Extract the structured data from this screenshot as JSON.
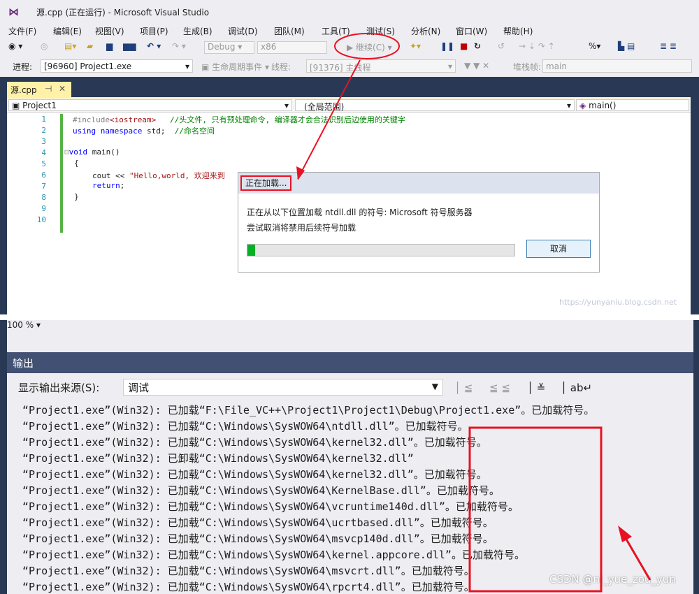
{
  "window": {
    "title": "源.cpp (正在运行) - Microsoft Visual Studio"
  },
  "menu": [
    "文件(F)",
    "编辑(E)",
    "视图(V)",
    "项目(P)",
    "生成(B)",
    "调试(D)",
    "团队(M)",
    "工具(T)",
    "测试(S)",
    "分析(N)",
    "窗口(W)",
    "帮助(H)"
  ],
  "toolbar": {
    "config": "Debug",
    "platform": "x86",
    "continue_label": "继续(C)"
  },
  "debugbar": {
    "process_label": "进程:",
    "process_value": "[96960] Project1.exe",
    "lifecycle_label": "生命周期事件",
    "thread_label": "线程:",
    "thread_value": "[91376] 主线程",
    "stack_label": "堆栈帧:",
    "stack_value": "main"
  },
  "editor": {
    "tab_label": "源.cpp",
    "nav_project": "Project1",
    "nav_scope": "(全局范围)",
    "nav_function": "main()",
    "line_numbers": [
      "1",
      "2",
      "3",
      "4",
      "5",
      "6",
      "7",
      "8",
      "9",
      "10"
    ],
    "code": {
      "l1_pp": "#include",
      "l1_str": "<iostream>",
      "l1_cm": "//头文件, 只有预处理命令, 编译器才会合法识别后边使用的关键字",
      "l2_kw": "using namespace",
      "l2_rest": " std;  ",
      "l2_cm": "//命名空间",
      "l4_kw": "void",
      "l4_rest": " main()",
      "l5": "{",
      "l6_rest": "cout << ",
      "l6_str": "\"Hello,world, 欢迎来到",
      "l7_kw": "return",
      "l8": "}"
    },
    "watermark": "https://yunyaniu.blog.csdn.net"
  },
  "dialog": {
    "title": "正在加载...",
    "message": "正在从以下位置加载 ntdll.dll 的符号: Microsoft 符号服务器",
    "hint": "尝试取消将禁用后续符号加载",
    "progress": 0.03,
    "cancel": "取消"
  },
  "output": {
    "zoom": "100 %",
    "header": "输出",
    "source_label": "显示输出来源(S):",
    "source_value": "调试",
    "lines": [
      "“Project1.exe”(Win32): 已加载“F:\\File_VC++\\Project1\\Project1\\Debug\\Project1.exe”。已加载符号。",
      "“Project1.exe”(Win32): 已加载“C:\\Windows\\SysWOW64\\ntdll.dll”。已加载符号。",
      "“Project1.exe”(Win32): 已加载“C:\\Windows\\SysWOW64\\kernel32.dll”。已加载符号。",
      "“Project1.exe”(Win32): 已卸载“C:\\Windows\\SysWOW64\\kernel32.dll”",
      "“Project1.exe”(Win32): 已加载“C:\\Windows\\SysWOW64\\kernel32.dll”。已加载符号。",
      "“Project1.exe”(Win32): 已加载“C:\\Windows\\SysWOW64\\KernelBase.dll”。已加载符号。",
      "“Project1.exe”(Win32): 已加载“C:\\Windows\\SysWOW64\\vcruntime140d.dll”。已加载符号。",
      "“Project1.exe”(Win32): 已加载“C:\\Windows\\SysWOW64\\ucrtbased.dll”。已加载符号。",
      "“Project1.exe”(Win32): 已加载“C:\\Windows\\SysWOW64\\msvcp140d.dll”。已加载符号。",
      "“Project1.exe”(Win32): 已加载“C:\\Windows\\SysWOW64\\kernel.appcore.dll”。已加载符号。",
      "“Project1.exe”(Win32): 已加载“C:\\Windows\\SysWOW64\\msvcrt.dll”。已加载符号。",
      "“Project1.exe”(Win32): 已加载“C:\\Windows\\SysWOW64\\rpcrt4.dll”。已加载符号。"
    ],
    "watermark": "CSDN @ni_yue_zou_yun"
  },
  "colors": {
    "annotation": "#e81123",
    "vs_dark": "#293955",
    "output_header": "#425073"
  }
}
